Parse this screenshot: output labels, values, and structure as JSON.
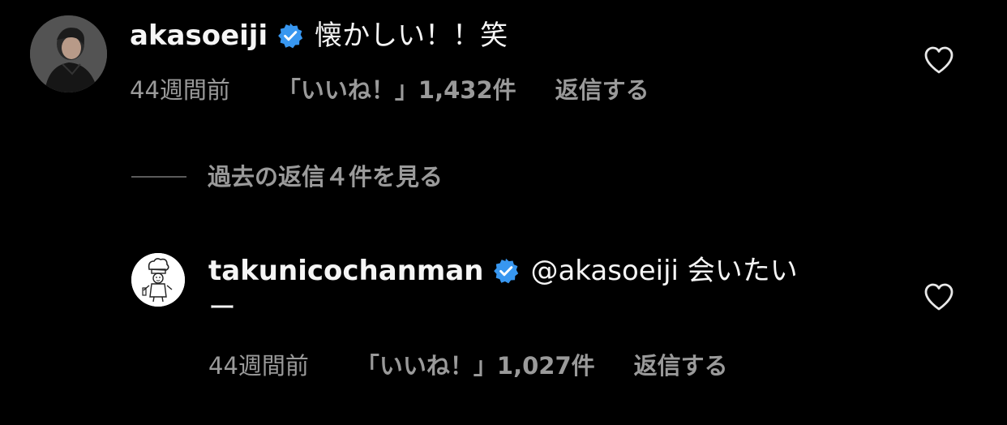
{
  "comment": {
    "username": "akasoeiji",
    "text": "懐かしい！！笑",
    "time": "44週間前",
    "likes": "「いいね！」1,432件",
    "reply_label": "返信する",
    "avatar_icon": "avatar-photo-icon"
  },
  "view_replies": {
    "label": "過去の返信４件を見る"
  },
  "reply": {
    "username": "takunicochanman",
    "text": "@akasoeiji 会いたい",
    "text_continuation": "ー",
    "time": "44週間前",
    "likes": "「いいね！」1,027件",
    "reply_label": "返信する",
    "avatar_icon": "chef-illustration-icon"
  },
  "colors": {
    "background": "#000000",
    "text": "#f5f5f5",
    "muted": "#9a9a9a",
    "verified": "#3897f0"
  },
  "icons": {
    "verified": "verified-badge-icon",
    "like": "heart-outline-icon"
  }
}
